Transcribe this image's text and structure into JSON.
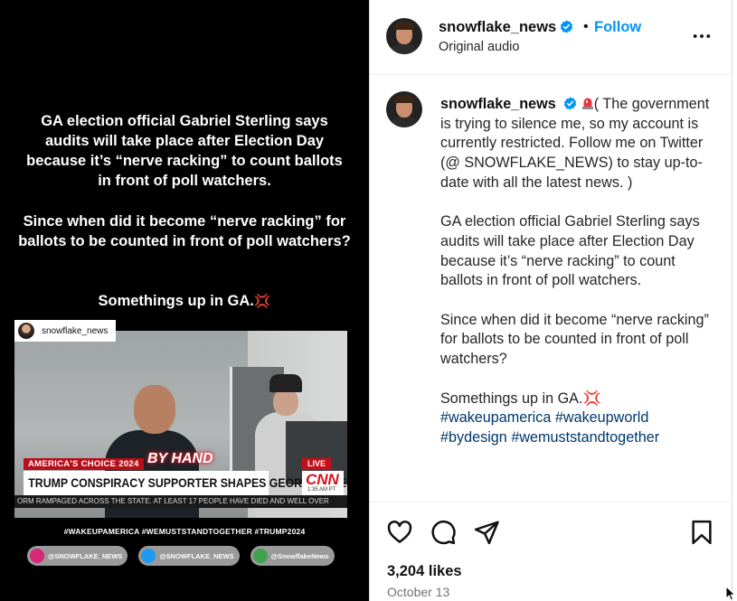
{
  "media": {
    "overlay_text_1": "GA election official Gabriel Sterling  says audits will take place after Election Day because it’s “nerve racking” to count ballots in front of poll watchers.",
    "overlay_text_2": "Since when did it become “nerve racking” for ballots to be counted in front of poll watchers?",
    "overlay_text_3": "Somethings up in GA.",
    "clip_username": "snowflake_news",
    "chyron_tag": "AMERICA'S CHOICE 2024",
    "chyron_tag_2": "BY HAND",
    "chyron_live": "LIVE",
    "chyron_headline": "TRUMP CONSPIRACY SUPPORTER SHAPES GEORGIA ELECTION RULES",
    "chyron_network": "CNN",
    "chyron_time": "1:35 AM PT",
    "chyron_ticker": "ORM RAMPAGED ACROSS THE STATE. AT LEAST 17 PEOPLE HAVE DIED AND WELL OVER",
    "image_hashtags": "#WAKEUPAMERICA #WEMUSTSTANDTOGETHER #TRUMP2024",
    "socials": [
      {
        "label": "@SNOWFLAKE_NEWS",
        "color": "#d6297a"
      },
      {
        "label": "@SNOWFLAKE_NEWS",
        "color": "#1d9bf0"
      },
      {
        "label": "@SnowflakeNews",
        "color": "#3fa34d"
      }
    ]
  },
  "header": {
    "username": "snowflake_news",
    "separator": "•",
    "follow_label": "Follow",
    "audio": "Original audio"
  },
  "caption": {
    "username": "snowflake_news",
    "para1": "( The government is trying to silence me, so my account is currently restricted. Follow me on Twitter (@ SNOWFLAKE_NEWS) to stay up-to-date with all the latest news. )",
    "para2": "GA election official Gabriel Sterling says audits will take place after Election Day because it’s “nerve racking” to count ballots in front of poll watchers.",
    "para3": "Since when did it become “nerve racking” for ballots to be counted in front of poll watchers?",
    "para4": "Somethings up in GA.",
    "hashtags": [
      "#wakeupamerica",
      "#wakeupworld",
      "#bydesign",
      "#wemuststandtogether"
    ]
  },
  "footer": {
    "likes": "3,204 likes",
    "date": "October 13"
  },
  "colors": {
    "accent": "#0095f6",
    "hashtag": "#00376b",
    "verified": "#0095f6"
  },
  "icons": [
    "verified-badge-icon",
    "more-options-icon",
    "heart-icon",
    "comment-icon",
    "share-icon",
    "bookmark-icon",
    "siren-emoji-icon",
    "anger-emoji-icon"
  ]
}
